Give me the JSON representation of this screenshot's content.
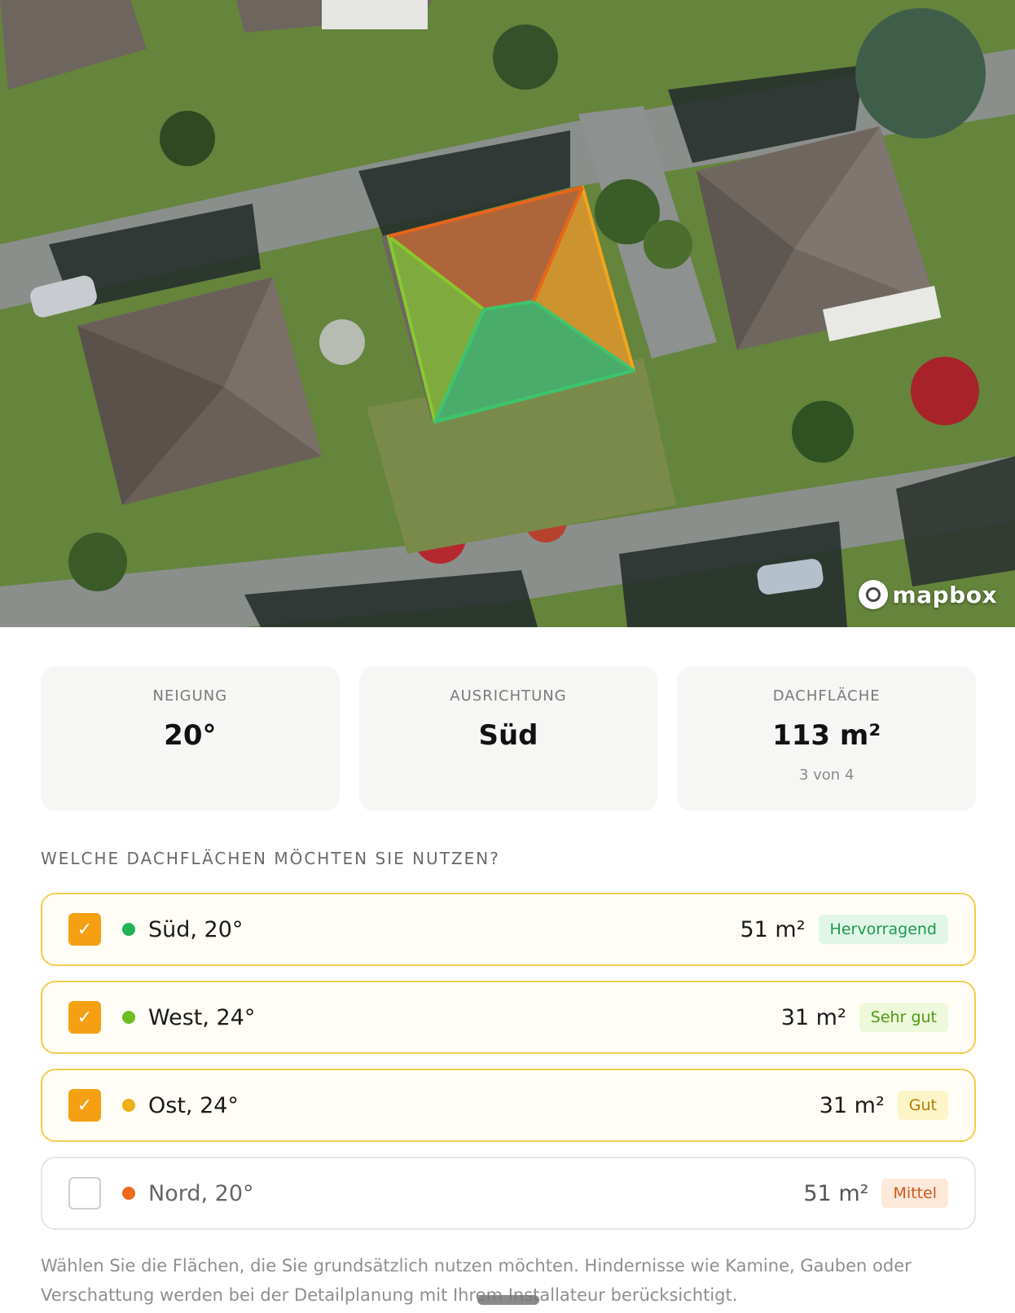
{
  "map": {
    "attribution": "mapbox",
    "icons": {
      "logo": "mapbox-logo-icon"
    },
    "roof_colors": {
      "sued": "#3ec46d",
      "west": "#86c930",
      "ost": "#f2a51c",
      "nord": "#e5651b"
    }
  },
  "stats": [
    {
      "label": "NEIGUNG",
      "value": "20°",
      "sub": ""
    },
    {
      "label": "AUSRICHTUNG",
      "value": "Süd",
      "sub": ""
    },
    {
      "label": "DACHFLÄCHE",
      "value": "113 m²",
      "sub": "3 von 4"
    }
  ],
  "question": "WELCHE DACHFLÄCHEN MÖCHTEN SIE NUTZEN?",
  "roofs": [
    {
      "name": "Süd, 20°",
      "area": "51 m²",
      "rating": "Hervorragend",
      "selected": true,
      "dot_color": "#22b355",
      "badge_bg": "#e2f6e8",
      "badge_fg": "#1d9a4c"
    },
    {
      "name": "West, 24°",
      "area": "31 m²",
      "rating": "Sehr gut",
      "selected": true,
      "dot_color": "#6bbf1f",
      "badge_bg": "#eef8da",
      "badge_fg": "#4f9a12"
    },
    {
      "name": "Ost, 24°",
      "area": "31 m²",
      "rating": "Gut",
      "selected": true,
      "dot_color": "#eeae15",
      "badge_bg": "#fdf4c8",
      "badge_fg": "#b08000"
    },
    {
      "name": "Nord, 20°",
      "area": "51 m²",
      "rating": "Mittel",
      "selected": false,
      "dot_color": "#ee6a1a",
      "badge_bg": "#fde9da",
      "badge_fg": "#d0561a"
    }
  ],
  "checkbox_icon": "checkmark-icon",
  "note": "Wählen Sie die Flächen, die Sie grundsätzlich nutzen möchten. Hindernisse wie Kamine, Gauben oder Verschattung werden bei der Detailplanung mit Ihrem Installateur berücksichtigt."
}
